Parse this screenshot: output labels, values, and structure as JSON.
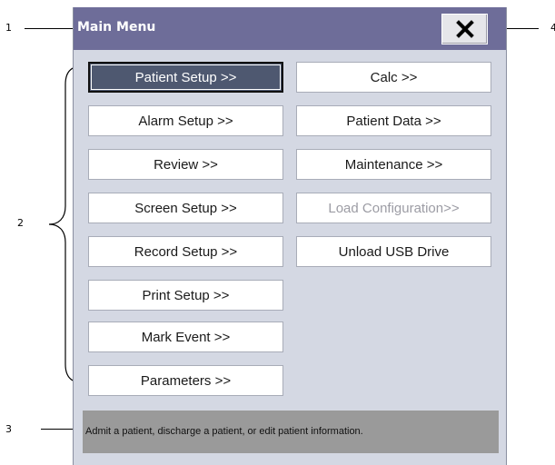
{
  "callouts": {
    "c1": "1",
    "c2": "2",
    "c3": "3",
    "c4": "4"
  },
  "window": {
    "title": "Main Menu",
    "close_icon": "close-x-icon"
  },
  "menu": {
    "left": [
      {
        "label": "Patient Setup >>",
        "state": "selected"
      },
      {
        "label": "Alarm Setup >>",
        "state": "normal"
      },
      {
        "label": "Review >>",
        "state": "normal"
      },
      {
        "label": "Screen Setup >>",
        "state": "normal"
      },
      {
        "label": "Record Setup >>",
        "state": "normal"
      },
      {
        "label": "Print Setup >>",
        "state": "normal"
      },
      {
        "label": "Mark Event >>",
        "state": "normal"
      },
      {
        "label": "Parameters >>",
        "state": "normal"
      }
    ],
    "right": [
      {
        "label": "Calc >>",
        "state": "normal"
      },
      {
        "label": "Patient Data >>",
        "state": "normal"
      },
      {
        "label": "Maintenance >>",
        "state": "normal"
      },
      {
        "label": "Load Configuration>>",
        "state": "disabled"
      },
      {
        "label": "Unload USB Drive",
        "state": "normal"
      }
    ]
  },
  "help": {
    "text": "Admit a patient, discharge a patient, or edit patient information."
  },
  "colors": {
    "titlebar": "#6e6d99",
    "window_bg": "#d4d8e3",
    "selected_button": "#4e5870",
    "helpbar": "#9a9a9a",
    "disabled_text": "#9c9ca4"
  }
}
